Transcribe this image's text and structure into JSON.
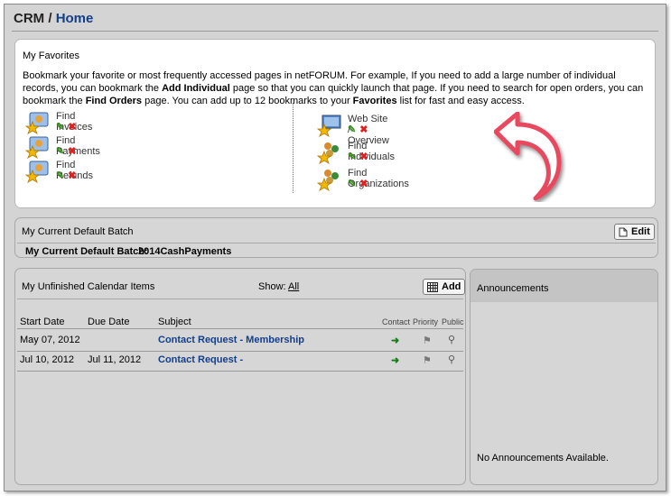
{
  "header": {
    "app": "CRM",
    "separator": "/",
    "page": "Home"
  },
  "favorites": {
    "title": "My Favorites",
    "intro": [
      {
        "t": "Bookmark your favorite or most frequently accessed pages in netFORUM. For example, If you need to add a large number of individual records, you can bookmark the ",
        "b": false
      },
      {
        "t": "Add Individual",
        "b": true
      },
      {
        "t": " page so that you can quickly launch that page. If you need to search for open orders, you can bookmark the ",
        "b": false
      },
      {
        "t": "Find Orders",
        "b": true
      },
      {
        "t": " page. You can add up to 12 bookmarks to your ",
        "b": false
      },
      {
        "t": "Favorites",
        "b": true
      },
      {
        "t": " list for fast and easy access.",
        "b": false
      }
    ],
    "left": [
      {
        "label": "Find Invoices",
        "icon": "invoice-icon"
      },
      {
        "label": "Find Payments",
        "icon": "payment-icon"
      },
      {
        "label": "Find Refunds",
        "icon": "refund-icon"
      }
    ],
    "right": [
      {
        "label": "Web Site / Overview",
        "icon": "website-icon"
      },
      {
        "label": "Find Individuals",
        "icon": "individuals-icon"
      },
      {
        "label": "Find Organizations",
        "icon": "organizations-icon"
      }
    ],
    "edit_glyph": "✎",
    "delete_glyph": "✖"
  },
  "batch": {
    "title": "My Current Default Batch",
    "edit_label": "Edit",
    "label": "My Current Default Batch:",
    "value": "2014CashPayments"
  },
  "calendar": {
    "title": "My Unfinished Calendar Items",
    "show_label": "Show:",
    "show_value": "All",
    "add_label": "Add",
    "columns": {
      "start": "Start Date",
      "due": "Due Date",
      "subject": "Subject",
      "contact": "Contact",
      "priority": "Priority",
      "public": "Public"
    },
    "rows": [
      {
        "start": "May 07, 2012",
        "due": "",
        "subject": "Contact Request - Membership"
      },
      {
        "start": "Jul 10, 2012",
        "due": "Jul 11, 2012",
        "subject": "Contact Request -"
      }
    ]
  },
  "announcements": {
    "title": "Announcements",
    "empty": "No Announcements Available."
  },
  "colors": {
    "accent": "#123f8a",
    "panel": "#d6d6d6",
    "arrow": "#e84a5f"
  }
}
